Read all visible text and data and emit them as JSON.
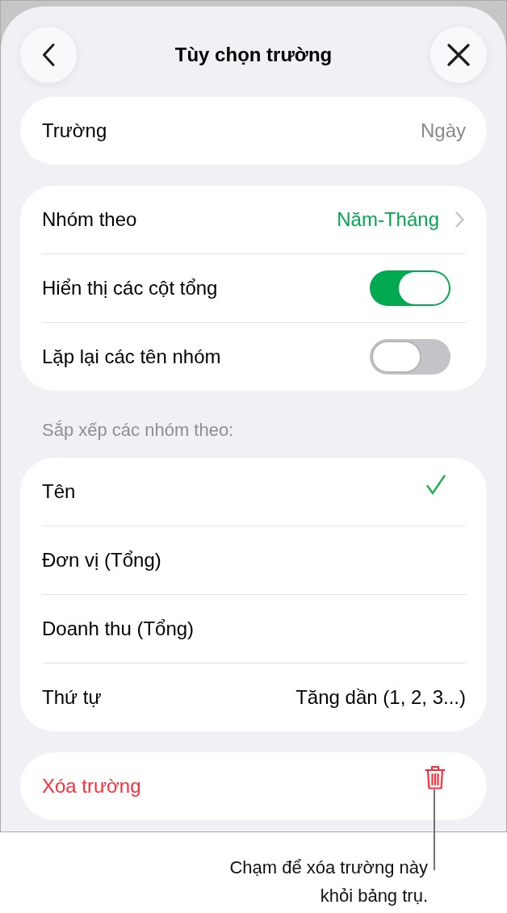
{
  "header": {
    "title": "Tùy chọn trường"
  },
  "field_card": {
    "label": "Trường",
    "value": "Ngày"
  },
  "group_card": {
    "rows": [
      {
        "kind": "link",
        "label": "Nhóm theo",
        "value": "Năm-Tháng"
      },
      {
        "kind": "toggle",
        "label": "Hiển thị các cột tổng",
        "on": true
      },
      {
        "kind": "toggle",
        "label": "Lặp lại các tên nhóm",
        "on": false
      }
    ]
  },
  "sort_section": {
    "header": "Sắp xếp các nhóm theo:",
    "options": [
      {
        "label": "Tên",
        "selected": true
      },
      {
        "label": "Đơn vị (Tổng)",
        "selected": false
      },
      {
        "label": "Doanh thu (Tổng)",
        "selected": false
      }
    ],
    "order": {
      "label": "Thứ tự",
      "value": "Tăng dần (1, 2, 3...)"
    }
  },
  "delete_button": {
    "label": "Xóa trường"
  },
  "callout": {
    "lines": [
      "Chạm để xóa trường này",
      "khỏi bảng trụ."
    ]
  }
}
